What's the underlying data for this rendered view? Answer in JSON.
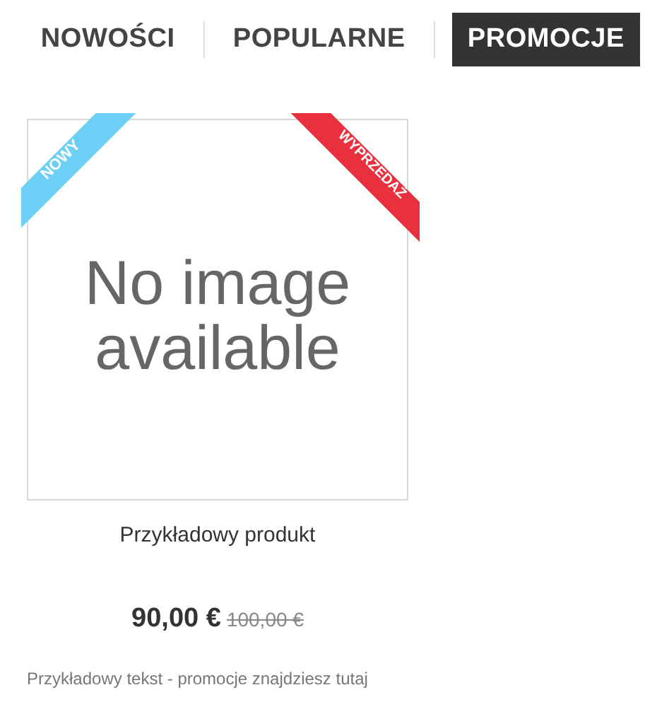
{
  "tabs": [
    {
      "label": "NOWOŚCI",
      "selected": false
    },
    {
      "label": "POPULARNE",
      "selected": false
    },
    {
      "label": "PROMOCJE",
      "selected": true
    }
  ],
  "product": {
    "image_text": "No image available",
    "ribbons": [
      {
        "kind": "left",
        "label": "NOWY",
        "color": "#6bcff6"
      },
      {
        "kind": "right",
        "label": "WYPRZEDAŻ",
        "color": "#e8303f"
      }
    ],
    "name": "Przykładowy produkt",
    "price": "90,00 €",
    "old_price": "100,00 €"
  },
  "note": "Przykładowy tekst - promocje znajdziesz tutaj"
}
